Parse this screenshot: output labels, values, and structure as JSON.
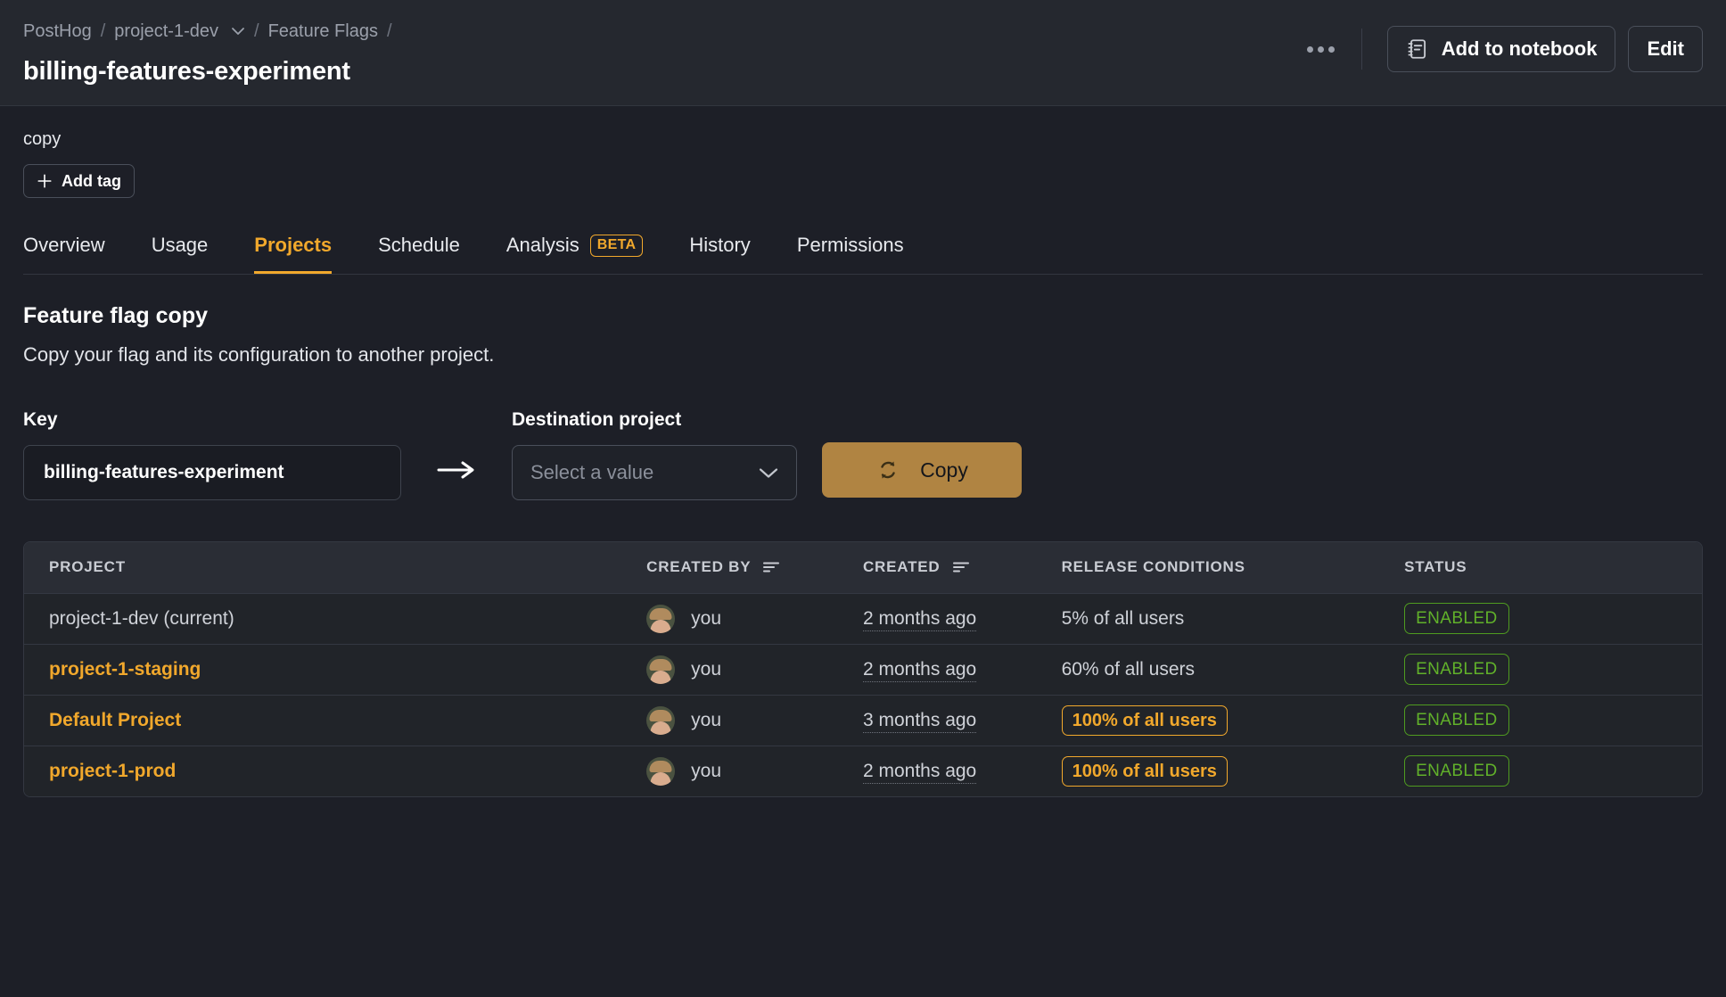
{
  "header": {
    "breadcrumb": [
      {
        "label": "PostHog",
        "has_chevron": false
      },
      {
        "label": "project-1-dev",
        "has_chevron": true
      },
      {
        "label": "Feature Flags",
        "has_chevron": false
      }
    ],
    "separator": "/",
    "title": "billing-features-experiment",
    "overflow_menu": "…",
    "add_to_notebook_label": "Add to notebook",
    "edit_label": "Edit"
  },
  "tags": {
    "current_tag": "copy",
    "add_tag_label": "Add tag"
  },
  "tabs": [
    {
      "label": "Overview",
      "active": false,
      "badge": null
    },
    {
      "label": "Usage",
      "active": false,
      "badge": null
    },
    {
      "label": "Projects",
      "active": true,
      "badge": null
    },
    {
      "label": "Schedule",
      "active": false,
      "badge": null
    },
    {
      "label": "Analysis",
      "active": false,
      "badge": "BETA"
    },
    {
      "label": "History",
      "active": false,
      "badge": null
    },
    {
      "label": "Permissions",
      "active": false,
      "badge": null
    }
  ],
  "copy_section": {
    "title": "Feature flag copy",
    "description": "Copy your flag and its configuration to another project.",
    "key_label": "Key",
    "key_value": "billing-features-experiment",
    "destination_label": "Destination project",
    "destination_placeholder": "Select a value",
    "copy_button_label": "Copy"
  },
  "table": {
    "columns": [
      {
        "label": "PROJECT",
        "sortable": false
      },
      {
        "label": "CREATED BY",
        "sortable": true
      },
      {
        "label": "CREATED",
        "sortable": true
      },
      {
        "label": "RELEASE CONDITIONS",
        "sortable": false
      },
      {
        "label": "STATUS",
        "sortable": false
      }
    ],
    "rows": [
      {
        "project": "project-1-dev (current)",
        "is_link": false,
        "created_by": "you",
        "created": "2 months ago",
        "release_conditions": "5% of all users",
        "release_boxed": false,
        "status": "ENABLED"
      },
      {
        "project": "project-1-staging",
        "is_link": true,
        "created_by": "you",
        "created": "2 months ago",
        "release_conditions": "60% of all users",
        "release_boxed": false,
        "status": "ENABLED"
      },
      {
        "project": "Default Project",
        "is_link": true,
        "created_by": "you",
        "created": "3 months ago",
        "release_conditions": "100% of all users",
        "release_boxed": true,
        "status": "ENABLED"
      },
      {
        "project": "project-1-prod",
        "is_link": true,
        "created_by": "you",
        "created": "2 months ago",
        "release_conditions": "100% of all users",
        "release_boxed": true,
        "status": "ENABLED"
      }
    ]
  },
  "colors": {
    "accent": "#f1a82c",
    "enabled_green": "#61b12a",
    "copy_button": "#b08442",
    "page_bg": "#1d1f27",
    "header_bg": "#25282f"
  }
}
